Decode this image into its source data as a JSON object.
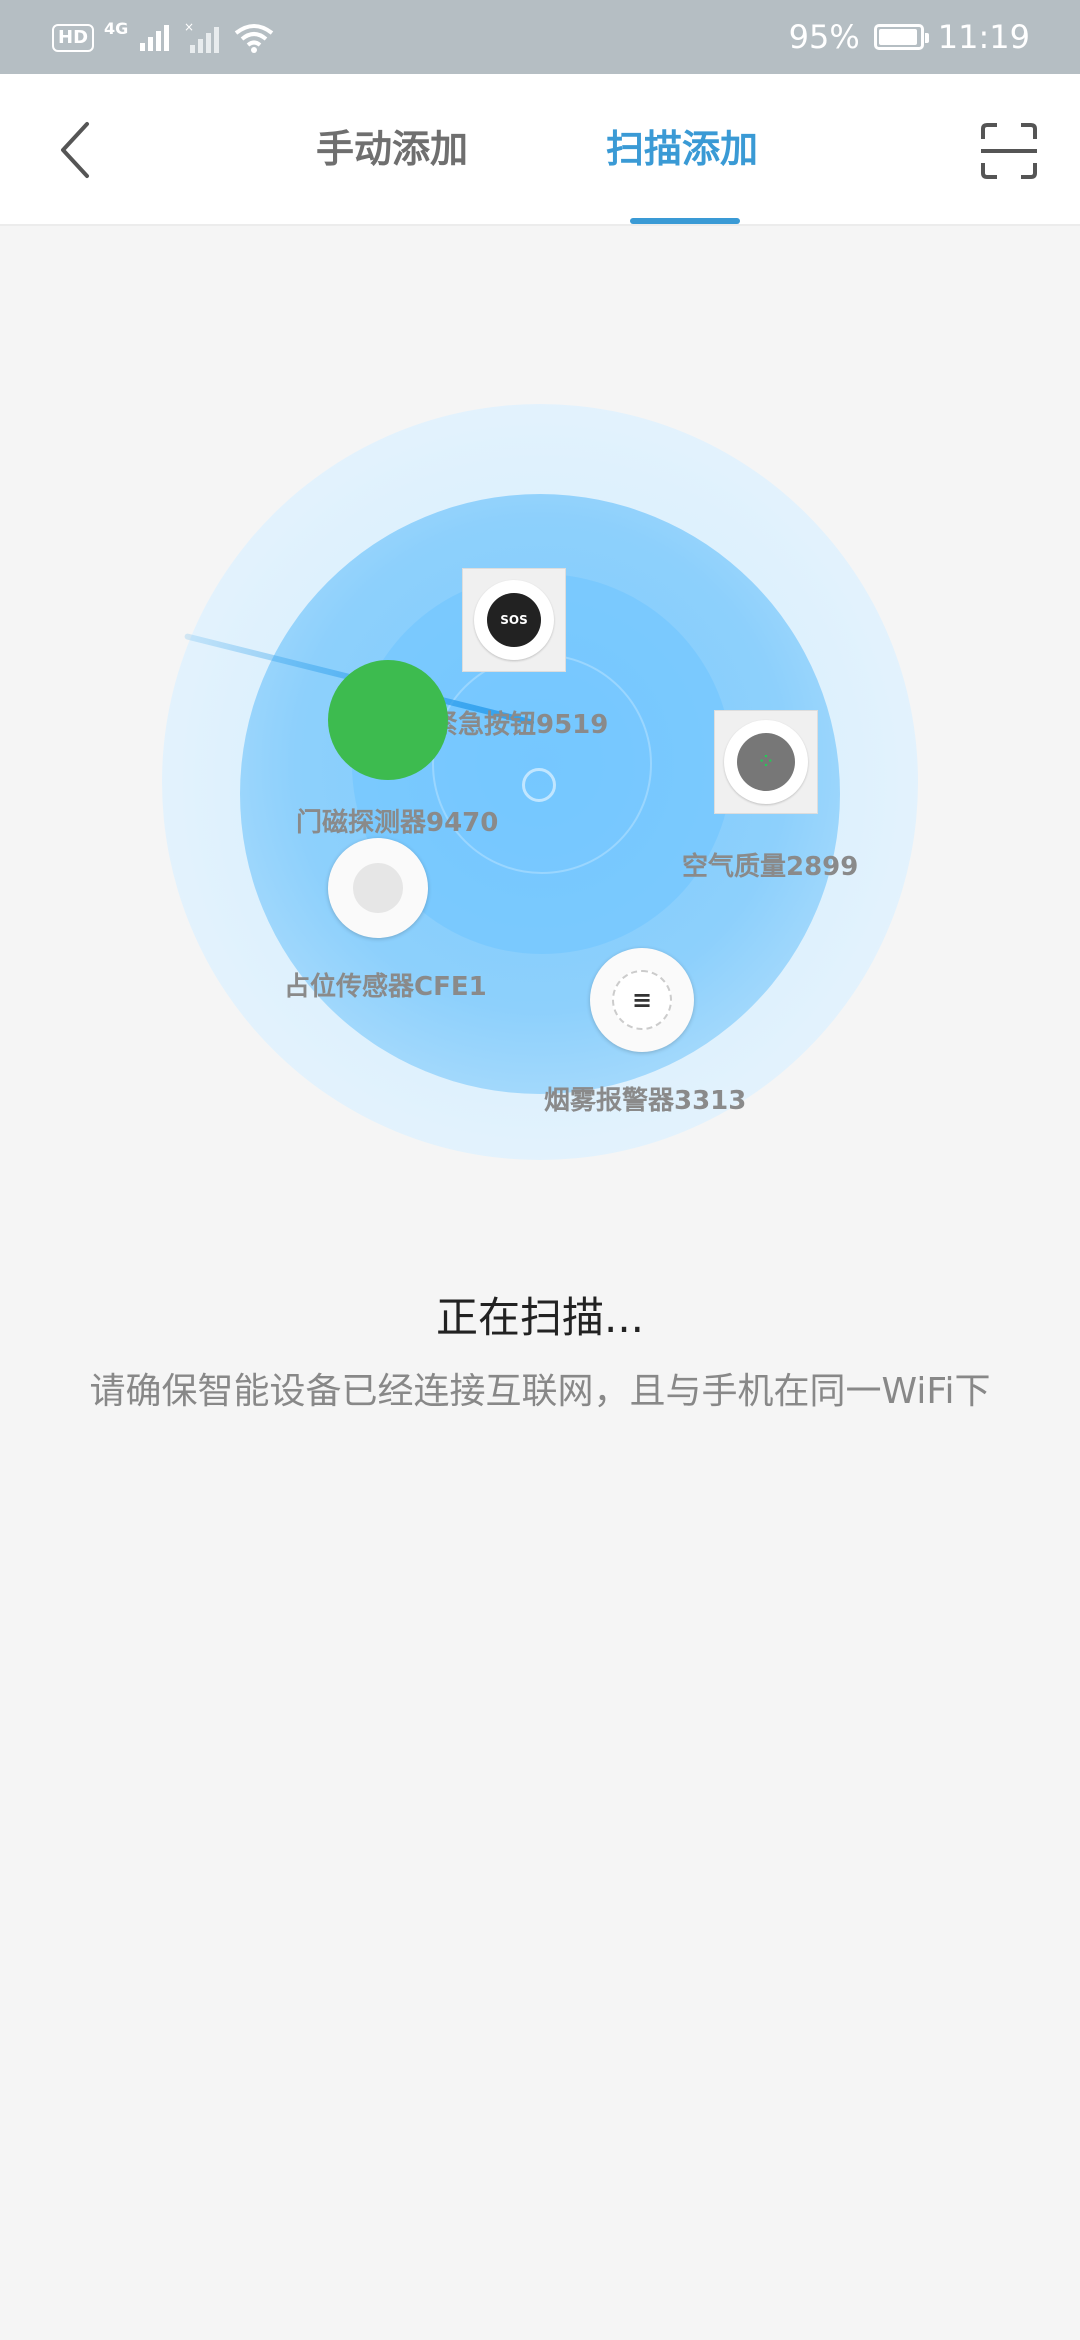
{
  "status_bar": {
    "hd": "HD",
    "network": "4G",
    "battery_percent": "95%",
    "battery_level": 0.95,
    "time": "11:19"
  },
  "header": {
    "back_icon": "chevron-left-icon",
    "tabs": [
      {
        "label": "手动添加",
        "active": false
      },
      {
        "label": "扫描添加",
        "active": true
      }
    ],
    "scan_icon": "scan-frame-icon",
    "accent_color": "#3a9ad5"
  },
  "radar": {
    "devices": [
      {
        "label": "紧急按钮9519",
        "icon": "sos-button-icon"
      },
      {
        "label": "门磁探测器9470",
        "icon": "door-sensor-icon"
      },
      {
        "label": "空气质量2899",
        "icon": "air-quality-icon"
      },
      {
        "label": "占位传感器CFE1",
        "icon": "occupancy-sensor-icon"
      },
      {
        "label": "烟雾报警器3313",
        "icon": "smoke-alarm-icon"
      }
    ],
    "sos_text": "SOS",
    "smoke_symbol": "≡"
  },
  "scan": {
    "title": "正在扫描...",
    "hint": "请确保智能设备已经连接互联网，且与手机在同一WiFi下"
  }
}
